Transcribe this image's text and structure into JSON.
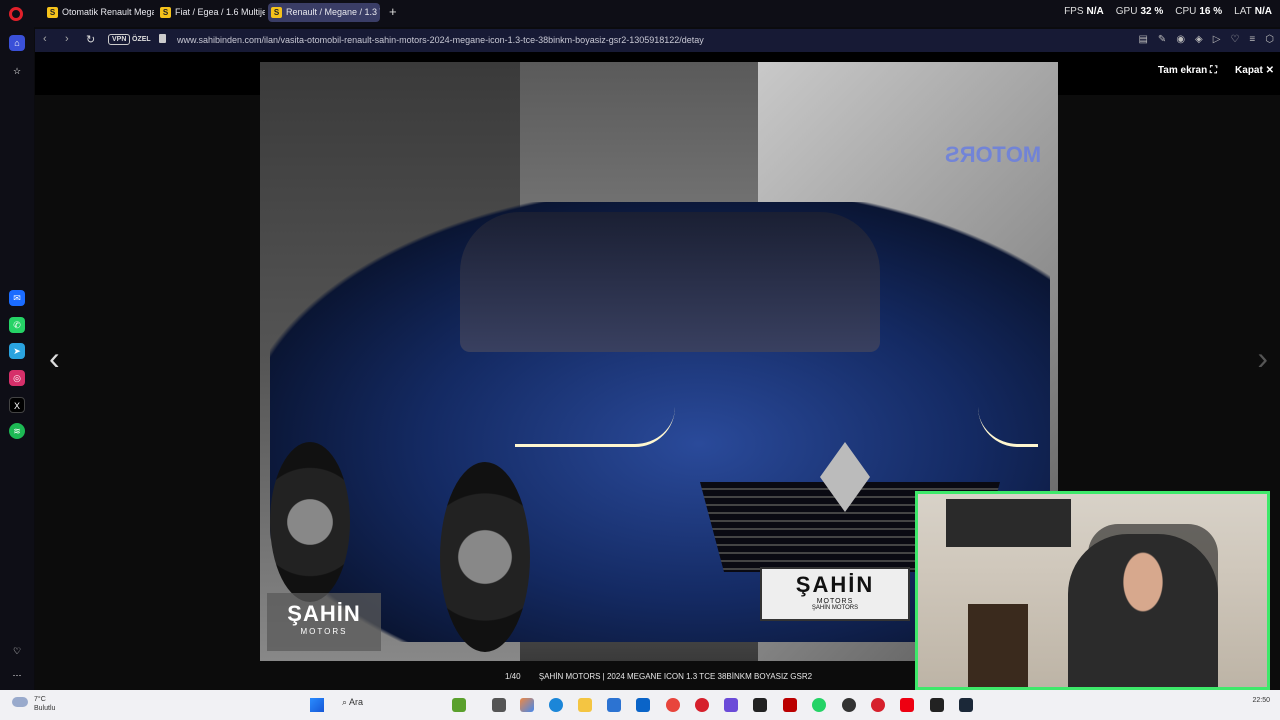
{
  "browser": {
    "tabs": [
      {
        "label": "Otomatik Renault Megane",
        "favicon": "S"
      },
      {
        "label": "Fiat / Egea / 1.6 Multijet /",
        "favicon": "S"
      },
      {
        "label": "Renault / Megane / 1.3 TC",
        "favicon": "S"
      }
    ],
    "vpn_label": "VPN",
    "private_label": "ÖZEL",
    "url": "www.sahibinden.com/ilan/vasita-otomobil-renault-sahin-motors-2024-megane-icon-1.3-tce-38binkm-boyasiz-gsr2-1305918122/detay"
  },
  "stats": {
    "fps_label": "FPS",
    "fps_value": "N/A",
    "gpu_label": "GPU",
    "gpu_value": "32 %",
    "cpu_label": "CPU",
    "cpu_value": "16 %",
    "lat_label": "LAT",
    "lat_value": "N/A"
  },
  "gallery": {
    "fullscreen_label": "Tam ekran",
    "close_label": "Kapat",
    "counter": "1/40",
    "caption": "ŞAHİN MOTORS | 2024 MEGANE ICON 1.3 TCE 38BİNKM BOYASIZ GSR2",
    "watermark_big": "ŞAHİN",
    "watermark_small": "MOTORS",
    "plate_big": "ŞAHİN",
    "plate_small": "MOTORS",
    "plate_tiny": "ŞAHİN MOTORS",
    "sign_text": "MOTORS"
  },
  "taskbar": {
    "weather_temp": "7°C",
    "weather_text": "Bulutlu",
    "search_label": "Ara",
    "clock": "22:50"
  },
  "colors": {
    "accent_tab": "#3a3d66",
    "webcam_border": "#3ee86a",
    "address_bar": "#171a35"
  }
}
